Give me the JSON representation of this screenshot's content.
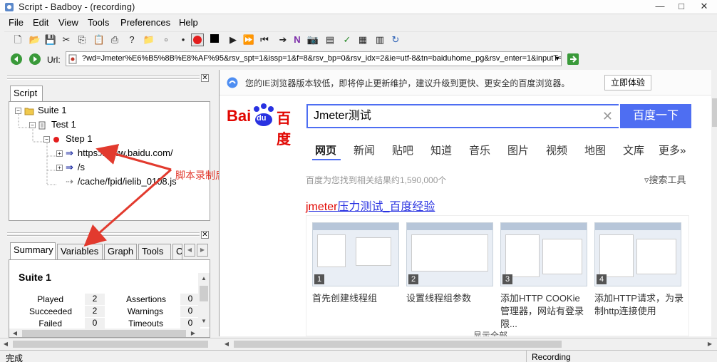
{
  "window": {
    "title": "Script - Badboy - (recording)",
    "min": "—",
    "max": "□",
    "close": "✕"
  },
  "menu": [
    "File",
    "Edit",
    "View",
    "Tools",
    "Preferences",
    "Help"
  ],
  "urlbar": {
    "label": "Url:",
    "value": "?wd=Jmeter%E6%B5%8B%E8%AF%95&rsv_spt=1&issp=1&f=8&rsv_bp=0&rsv_idx=2&ie=utf-8&tn=baiduhome_pg&rsv_enter=1&inputT=10342"
  },
  "left_panel": {
    "script_tab": "Script",
    "tree": {
      "suite": "Suite 1",
      "test": "Test 1",
      "step": "Step 1",
      "requests": [
        "https://www.baidu.com/",
        "/s",
        "/cache/fpid/ielib_0108.js"
      ]
    },
    "annotation": "脚本录制后，点击左下角",
    "tabs": [
      "Summary",
      "Variables",
      "Graph",
      "Tools",
      "C"
    ],
    "summary": {
      "title": "Suite 1",
      "rows": [
        {
          "label": "Played",
          "value": "2",
          "label2": "Assertions",
          "value2": "0"
        },
        {
          "label": "Succeeded",
          "value": "2",
          "label2": "Warnings",
          "value2": "0"
        },
        {
          "label": "Failed",
          "value": "0",
          "label2": "Timeouts",
          "value2": "0"
        }
      ]
    }
  },
  "browser": {
    "notice": "您的IE浏览器版本较低，即将停止更新维护，建议升级到更快、更安全的百度浏览器。",
    "notice_button": "立即体验",
    "logo_text": "Bai",
    "logo_paw": "du",
    "logo_cn": "百度",
    "search_value": "Jmeter测试",
    "search_button": "百度一下",
    "nav_tabs": [
      "网页",
      "新闻",
      "贴吧",
      "知道",
      "音乐",
      "图片",
      "视频",
      "地图",
      "文库",
      "更多»"
    ],
    "result_count": "百度为您找到相关结果约1,590,000个",
    "search_tools": "搜索工具",
    "result_title_highlight": "jmeter",
    "result_title_rest": "压力测试_百度经验",
    "thumbnails": [
      {
        "num": "1",
        "caption": "首先创建线程组"
      },
      {
        "num": "2",
        "caption": "设置线程组参数"
      },
      {
        "num": "3",
        "caption": "添加HTTP COOKie 管理器，网站有登录限..."
      },
      {
        "num": "4",
        "caption": "添加HTTP请求，为录制http连接使用"
      }
    ],
    "show_all": "显示全部"
  },
  "status": {
    "left": "完成",
    "right": "Recording"
  },
  "colors": {
    "accent": "#4e6ef2",
    "arrow": "#e23a2e",
    "baidu_red": "#e10601",
    "baidu_blue": "#2932e1"
  }
}
